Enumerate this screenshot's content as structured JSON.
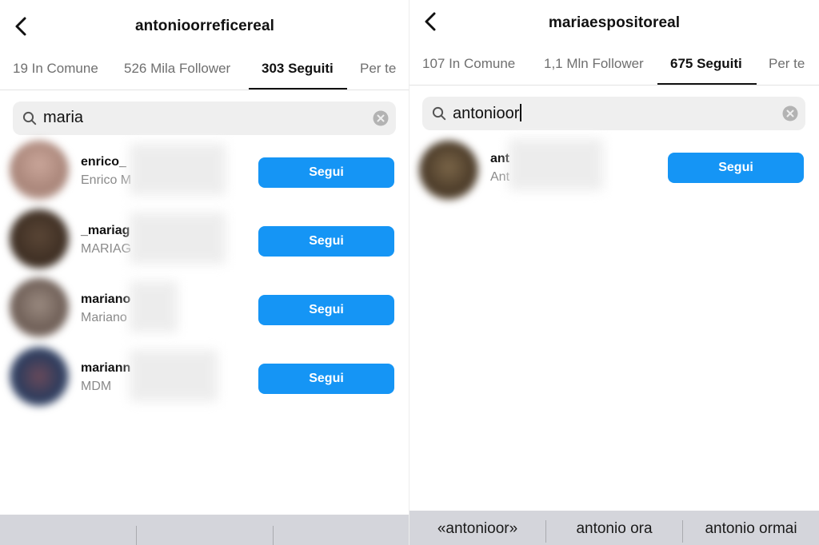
{
  "left": {
    "title": "antonioorreficereal",
    "tabs": [
      {
        "label": "19 In Comune"
      },
      {
        "label": "526 Mila Follower"
      },
      {
        "label": "303 Seguiti",
        "active": true
      },
      {
        "label": "Per te"
      }
    ],
    "search": {
      "query": "maria"
    },
    "results": [
      {
        "username": "enrico_",
        "fullname": "Enrico M",
        "button": "Segui"
      },
      {
        "username": "_mariag",
        "fullname": "MARIAG",
        "button": "Segui"
      },
      {
        "username": "mariano",
        "fullname": "Mariano",
        "button": "Segui"
      },
      {
        "username": "mariann",
        "fullname": "MDM",
        "button": "Segui"
      }
    ]
  },
  "right": {
    "title": "mariaespositoreal",
    "tabs": [
      {
        "label": "107 In Comune"
      },
      {
        "label": "1,1 Mln Follower"
      },
      {
        "label": "675 Seguiti",
        "active": true
      },
      {
        "label": "Per te"
      }
    ],
    "search": {
      "query": "antonioor"
    },
    "results": [
      {
        "username": "ant",
        "fullname": "Ant",
        "button": "Segui"
      }
    ],
    "keyboard_suggestions": [
      "«antonioor»",
      "antonio ora",
      "antonio ormai"
    ]
  },
  "colors": {
    "accent": "#1595f5",
    "search_bg": "#efefef",
    "keyboard_bg": "#d4d5db",
    "muted_text": "#6f6f6f"
  },
  "icons": [
    "back-chevron-icon",
    "search-icon",
    "clear-icon"
  ]
}
